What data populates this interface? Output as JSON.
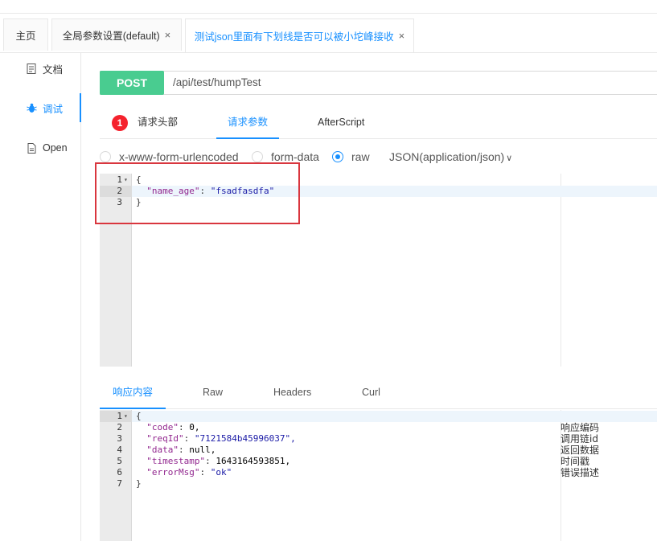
{
  "tabs": [
    {
      "label": "主页",
      "closable": false,
      "active": false
    },
    {
      "label": "全局参数设置(default)",
      "closable": true,
      "active": false
    },
    {
      "label": "测试json里面有下划线是否可以被小坨峰接收",
      "closable": true,
      "active": true
    }
  ],
  "close_glyph": "×",
  "sidebar": {
    "items": [
      {
        "label": "文档",
        "icon": "document-icon",
        "active": false
      },
      {
        "label": "调试",
        "icon": "bug-icon",
        "active": true
      },
      {
        "label": "Open",
        "icon": "file-icon",
        "active": false
      }
    ]
  },
  "request": {
    "method": "POST",
    "url": "/api/test/humpTest",
    "method_color": "#49cc90"
  },
  "request_tabs": {
    "badge_count": "1",
    "items": [
      "请求头部",
      "请求参数",
      "AfterScript"
    ],
    "active_index": 1
  },
  "body_types": {
    "options": [
      "x-www-form-urlencoded",
      "form-data",
      "raw"
    ],
    "selected": "raw",
    "content_type": "JSON(application/json)",
    "chevron": "∨"
  },
  "request_editor": {
    "lines": [
      {
        "n": "1",
        "fold": "▾",
        "text": "{"
      },
      {
        "n": "2",
        "fold": "",
        "key": "\"name_age\"",
        "sep": ": ",
        "value": "\"fsadfasdfa\""
      },
      {
        "n": "3",
        "fold": "",
        "text": "}"
      }
    ]
  },
  "response_tabs": {
    "items": [
      "响应内容",
      "Raw",
      "Headers",
      "Curl"
    ],
    "active_index": 0
  },
  "response_editor": {
    "lines": [
      {
        "n": "1",
        "fold": "▾",
        "text": "{"
      },
      {
        "n": "2",
        "fold": "",
        "key": "\"code\"",
        "sep": ": ",
        "value": "0,",
        "value_type": "num",
        "note": "响应编码"
      },
      {
        "n": "3",
        "fold": "",
        "key": "\"reqId\"",
        "sep": ": ",
        "value": "\"7121584b45996037\",",
        "value_type": "str",
        "note": "调用链id"
      },
      {
        "n": "4",
        "fold": "",
        "key": "\"data\"",
        "sep": ": ",
        "value": "null,",
        "value_type": "num",
        "note": "返回数据"
      },
      {
        "n": "5",
        "fold": "",
        "key": "\"timestamp\"",
        "sep": ": ",
        "value": "1643164593851,",
        "value_type": "num",
        "note": "时间戳"
      },
      {
        "n": "6",
        "fold": "",
        "key": "\"errorMsg\"",
        "sep": ": ",
        "value": "\"ok\"",
        "value_type": "str",
        "note": "错误描述"
      },
      {
        "n": "7",
        "fold": "",
        "text": "}"
      }
    ]
  },
  "colors": {
    "accent": "#1890ff",
    "highlight": "#d9363e",
    "badge": "#f5222d"
  }
}
